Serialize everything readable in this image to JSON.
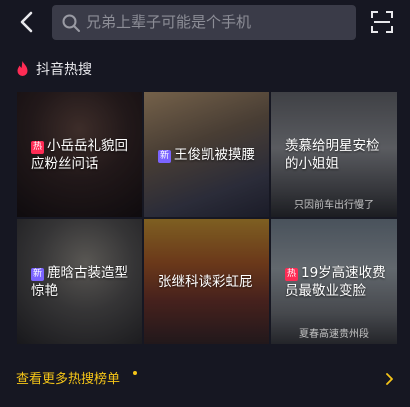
{
  "search": {
    "placeholder": "兄弟上辈子可能是个手机"
  },
  "section": {
    "title": "抖音热搜"
  },
  "tiles": [
    {
      "badge": "热",
      "badge_type": "hot",
      "text": "小岳岳礼貌回应粉丝问话"
    },
    {
      "badge": "新",
      "badge_type": "new",
      "text": "王俊凯被摸腰"
    },
    {
      "badge": "",
      "badge_type": "none",
      "text": "羡慕给明星安检的小姐姐",
      "stamp": "只因前车出行慢了"
    },
    {
      "badge": "新",
      "badge_type": "new",
      "text": "鹿晗古装造型惊艳"
    },
    {
      "badge": "",
      "badge_type": "none",
      "text": "张继科读彩虹屁"
    },
    {
      "badge": "热",
      "badge_type": "hot",
      "text": "19岁高速收费员最敬业变脸",
      "stamp": "夏春高速贵州段"
    }
  ],
  "footer": {
    "more_label": "查看更多热搜榜单"
  },
  "colors": {
    "background": "#161722",
    "accent": "#f5c518",
    "hot_badge": "#fe2c55",
    "new_badge": "#7b64ff"
  },
  "icons": {
    "back": "chevron-left-icon",
    "search": "search-icon",
    "scan": "scan-icon",
    "flame": "flame-icon",
    "more": "chevron-right-icon"
  }
}
